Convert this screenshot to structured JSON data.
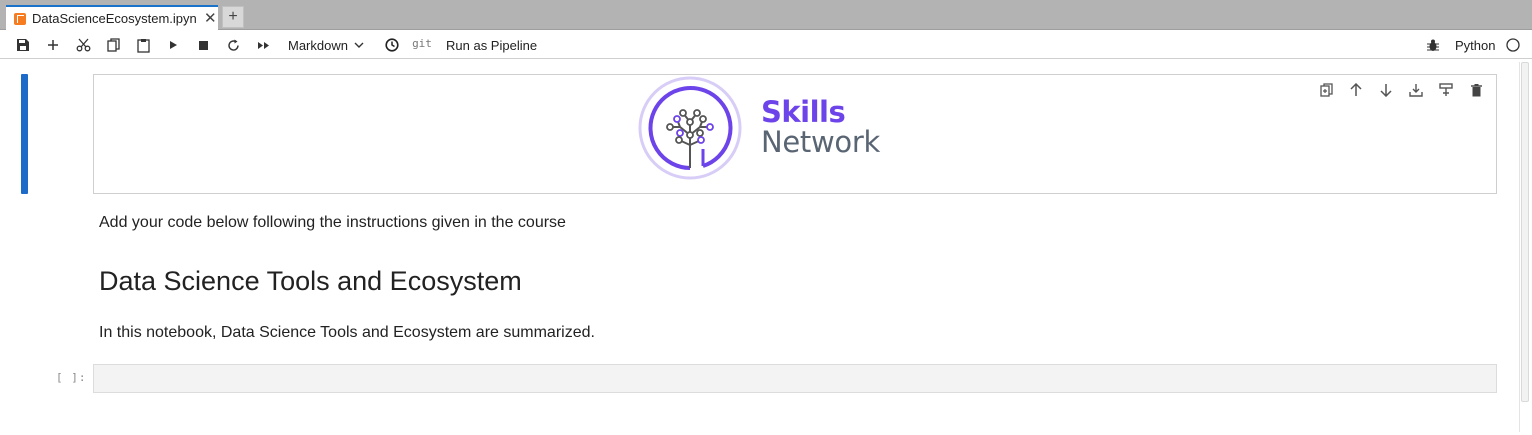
{
  "tab": {
    "title": "DataScienceEcosystem.ipyn",
    "close_glyph": "✕",
    "new_glyph": "+"
  },
  "toolbar": {
    "save_icon": "save-icon",
    "add_icon": "plus-icon",
    "cut_icon": "scissors-icon",
    "copy_icon": "copy-icon",
    "paste_icon": "paste-icon",
    "run_icon": "play-icon",
    "stop_icon": "stop-icon",
    "restart_icon": "restart-icon",
    "run_all_icon": "fast-forward-icon",
    "cell_type": "Markdown",
    "history_icon": "clock-icon",
    "git_label": "git",
    "pipeline_label": "Run as Pipeline",
    "debug_icon": "bug-icon",
    "kernel_name": "Python",
    "kernel_status_icon": "kernel-idle-circle-icon"
  },
  "cells": {
    "image_cell": {
      "logo": {
        "line1": "Skills",
        "line2": "Network"
      },
      "tools": [
        "duplicate-icon",
        "move-up-icon",
        "move-down-icon",
        "insert-above-icon",
        "insert-below-icon",
        "delete-icon"
      ]
    },
    "markdown": {
      "intro": "Add your code below following the instructions given in the course",
      "heading": "Data Science Tools and Ecosystem",
      "summary": "In this notebook, Data Science Tools and Ecosystem are summarized."
    },
    "code_cell": {
      "prompt": "[ ]:",
      "source": ""
    }
  },
  "colors": {
    "active_cell_bar": "#1c6bc9",
    "logo_purple": "#6d43ea",
    "logo_gray": "#5a6574",
    "tab_accent": "#1a73c8",
    "notebook_icon": "#f57c21"
  }
}
